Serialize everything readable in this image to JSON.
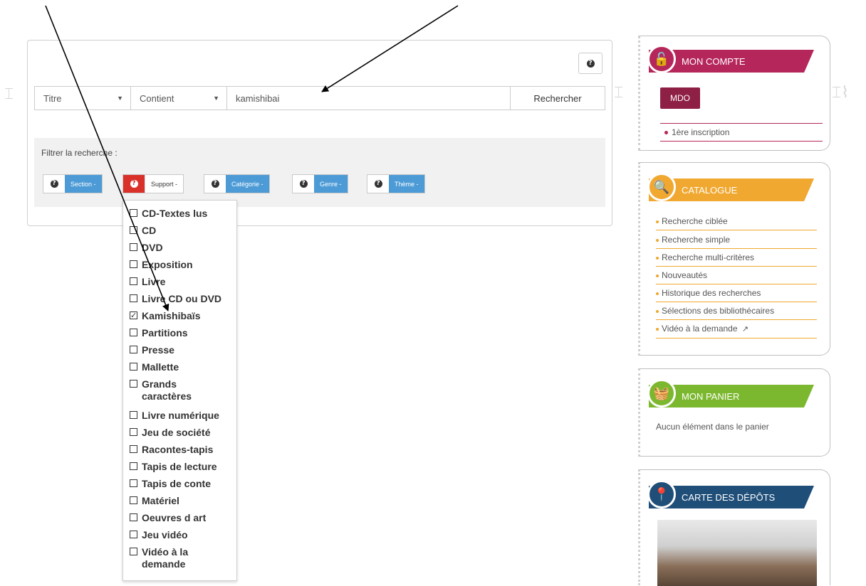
{
  "search": {
    "help_glyph": "?",
    "field_value": "Titre",
    "operator_value": "Contient",
    "query_value": "kamishibai",
    "submit_label": "Rechercher"
  },
  "filters": {
    "label": "Filtrer la recherche :",
    "buttons": [
      {
        "label": "Section -",
        "active": false
      },
      {
        "label": "Support -",
        "active": true
      },
      {
        "label": "Catégorie -",
        "active": false
      },
      {
        "label": "Genre -",
        "active": false
      },
      {
        "label": "Thème -",
        "active": false
      }
    ]
  },
  "support_options": [
    {
      "label": "CD-Textes lus",
      "checked": false
    },
    {
      "label": "CD",
      "checked": false
    },
    {
      "label": "DVD",
      "checked": false
    },
    {
      "label": "Exposition",
      "checked": false
    },
    {
      "label": "Livre",
      "checked": false
    },
    {
      "label": "Livre CD ou DVD",
      "checked": false
    },
    {
      "label": "Kamishibaïs",
      "checked": true
    },
    {
      "label": "Partitions",
      "checked": false
    },
    {
      "label": "Presse",
      "checked": false
    },
    {
      "label": "Mallette",
      "checked": false
    },
    {
      "label": "Grands caractères",
      "checked": false
    },
    {
      "label": "Livre numérique",
      "checked": false
    },
    {
      "label": "Jeu de société",
      "checked": false
    },
    {
      "label": "Racontes-tapis",
      "checked": false
    },
    {
      "label": "Tapis de lecture",
      "checked": false
    },
    {
      "label": "Tapis de conte",
      "checked": false
    },
    {
      "label": "Matériel",
      "checked": false
    },
    {
      "label": "Oeuvres d art",
      "checked": false
    },
    {
      "label": "Jeu vidéo",
      "checked": false
    },
    {
      "label": "Vidéo à la demande",
      "checked": false
    }
  ],
  "account": {
    "title": "MON COMPTE",
    "user_button": "MDO",
    "link": "1ère inscription",
    "color": "#b5265a"
  },
  "catalogue": {
    "title": "CATALOGUE",
    "color": "#f0a830",
    "links": [
      "Recherche ciblée",
      "Recherche simple",
      "Recherche multi-critères",
      "Nouveautés",
      "Historique des recherches",
      "Sélections des bibliothécaires",
      "Vidéo à la demande"
    ]
  },
  "cart": {
    "title": "MON PANIER",
    "empty_text": "Aucun élément dans le panier",
    "color": "#7cb82f"
  },
  "depots": {
    "title": "CARTE DES DÉPÔTS",
    "color": "#1f4e79"
  }
}
